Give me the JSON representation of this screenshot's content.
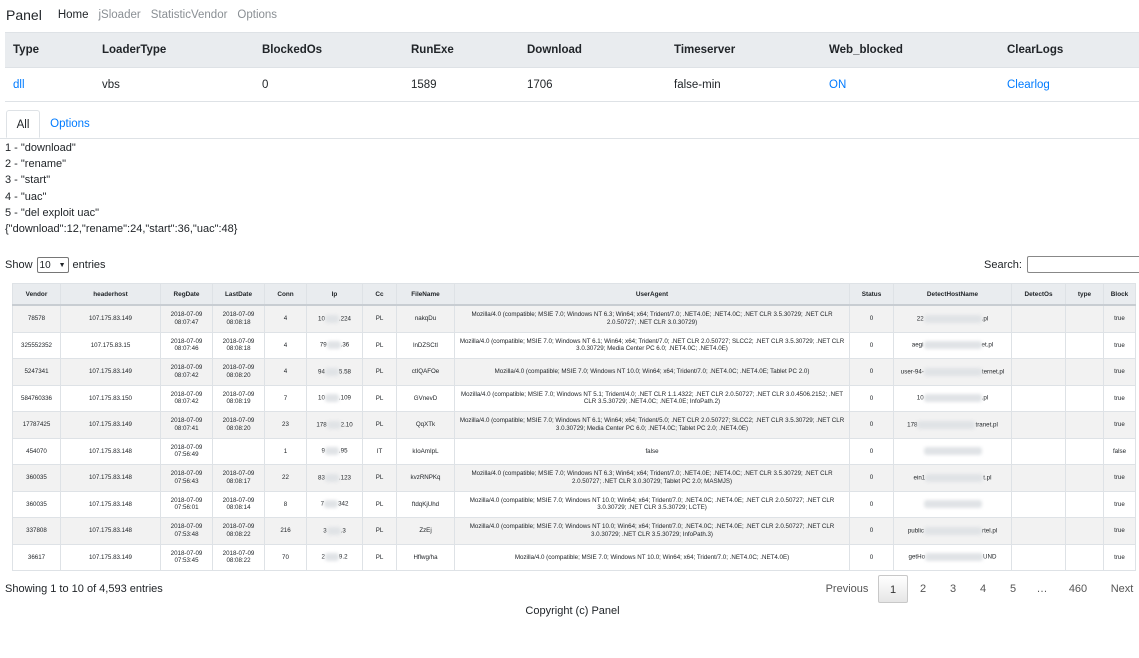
{
  "nav": {
    "brand": "Panel",
    "items": [
      "Home",
      "jSloader",
      "StatisticVendor",
      "Options"
    ]
  },
  "summary": {
    "headers": [
      "Type",
      "LoaderType",
      "BlockedOs",
      "RunExe",
      "Download",
      "Timeserver",
      "Web_blocked",
      "ClearLogs"
    ],
    "row": [
      "dll",
      "vbs",
      "0",
      "1589",
      "1706",
      "false-min",
      "ON",
      "Clearlog"
    ]
  },
  "tabs": [
    "All",
    "Options"
  ],
  "legend": [
    "1 - \"download\"",
    "2 - \"rename\"",
    "3 - \"start\"",
    "4 - \"uac\"",
    "5 - \"del exploit uac\"",
    "{\"download\":12,\"rename\":24,\"start\":36,\"uac\":48}"
  ],
  "length": {
    "show": "Show",
    "value": "10",
    "entries": "entries"
  },
  "search": {
    "label": "Search:"
  },
  "table": {
    "headers": [
      "Vendor",
      "headerhost",
      "RegDate",
      "LastDate",
      "Conn",
      "Ip",
      "Cc",
      "FileName",
      "UserAgent",
      "Status",
      "DetectHostName",
      "DetectOs",
      "type",
      "Block"
    ],
    "rows": [
      {
        "vendor": "78578",
        "host": "107.175.83.149",
        "reg": "2018-07-09 08:07:47",
        "last": "2018-07-09 08:08:18",
        "conn": "4",
        "ip_a": "10",
        "ip_b": ".224",
        "cc": "PL",
        "file": "nakqDu",
        "ua": "Mozilla/4.0 (compatible; MSIE 7.0; Windows NT 6.3; Win64; x64; Trident/7.0; .NET4.0E; .NET4.0C; .NET CLR 3.5.30729; .NET CLR 2.0.50727; .NET CLR 3.0.30729)",
        "status": "0",
        "dh_a": "22",
        "dh_b": ".pl",
        "block": "true"
      },
      {
        "vendor": "325552352",
        "host": "107.175.83.15",
        "reg": "2018-07-09 08:07:46",
        "last": "2018-07-09 08:08:18",
        "conn": "4",
        "ip_a": "79",
        "ip_b": ".36",
        "cc": "PL",
        "file": "lnDZSCtl",
        "ua": "Mozilla/4.0 (compatible; MSIE 7.0; Windows NT 6.1; Win64; x64; Trident/7.0; .NET CLR 2.0.50727; SLCC2; .NET CLR 3.5.30729; .NET CLR 3.0.30729; Media Center PC 6.0; .NET4.0C; .NET4.0E)",
        "status": "0",
        "dh_a": "aegi",
        "dh_b": "et.pl",
        "block": "true"
      },
      {
        "vendor": "5247341",
        "host": "107.175.83.149",
        "reg": "2018-07-09 08:07:42",
        "last": "2018-07-09 08:08:20",
        "conn": "4",
        "ip_a": "94",
        "ip_b": "5.58",
        "cc": "PL",
        "file": "ctIQAFOe",
        "ua": "Mozilla/4.0 (compatible; MSIE 7.0; Windows NT 10.0; Win64; x64; Trident/7.0; .NET4.0C; .NET4.0E; Tablet PC 2.0)",
        "status": "0",
        "dh_a": "user-94-",
        "dh_b": "ternet.pl",
        "block": "true"
      },
      {
        "vendor": "584760336",
        "host": "107.175.83.150",
        "reg": "2018-07-09 08:07:42",
        "last": "2018-07-09 08:08:19",
        "conn": "7",
        "ip_a": "10",
        "ip_b": ".109",
        "cc": "PL",
        "file": "GVnevD",
        "ua": "Mozilla/4.0 (compatible; MSIE 7.0; Windows NT 5.1; Trident/4.0; .NET CLR 1.1.4322; .NET CLR 2.0.50727; .NET CLR 3.0.4506.2152; .NET CLR 3.5.30729; .NET4.0C; .NET4.0E; InfoPath.2)",
        "status": "0",
        "dh_a": "10",
        "dh_b": ".pl",
        "block": "true"
      },
      {
        "vendor": "17787425",
        "host": "107.175.83.149",
        "reg": "2018-07-09 08:07:41",
        "last": "2018-07-09 08:08:20",
        "conn": "23",
        "ip_a": "178",
        "ip_b": "2.10",
        "cc": "PL",
        "file": "QqXTk",
        "ua": "Mozilla/4.0 (compatible; MSIE 7.0; Windows NT 6.1; Win64; x64; Trident/5.0; .NET CLR 2.0.50727; SLCC2; .NET CLR 3.5.30729; .NET CLR 3.0.30729; Media Center PC 6.0; .NET4.0C; Tablet PC 2.0; .NET4.0E)",
        "status": "0",
        "dh_a": "178",
        "dh_b": "tranet.pl",
        "block": "true"
      },
      {
        "vendor": "454070",
        "host": "107.175.83.148",
        "reg": "2018-07-09 07:56:49",
        "last": "",
        "conn": "1",
        "ip_a": "9",
        "ip_b": ".95",
        "cc": "IT",
        "file": "kIoAmIpL",
        "ua": "false",
        "status": "0",
        "dh_a": "",
        "dh_b": "",
        "block": "false"
      },
      {
        "vendor": "360035",
        "host": "107.175.83.148",
        "reg": "2018-07-09 07:56:43",
        "last": "2018-07-09 08:08:17",
        "conn": "22",
        "ip_a": "83",
        "ip_b": ".123",
        "cc": "PL",
        "file": "kvzRNPKq",
        "ua": "Mozilla/4.0 (compatible; MSIE 7.0; Windows NT 6.3; Win64; x64; Trident/7.0; .NET4.0E; .NET4.0C; .NET CLR 3.5.30729; .NET CLR 2.0.50727; .NET CLR 3.0.30729; Tablet PC 2.0; MASMJS)",
        "status": "0",
        "dh_a": "ein1",
        "dh_b": "t.pl",
        "block": "true"
      },
      {
        "vendor": "360035",
        "host": "107.175.83.148",
        "reg": "2018-07-09 07:56:01",
        "last": "2018-07-09 08:08:14",
        "conn": "8",
        "ip_a": "7",
        "ip_b": "342",
        "cc": "PL",
        "file": "ftdqKjUhd",
        "ua": "Mozilla/4.0 (compatible; MSIE 7.0; Windows NT 10.0; Win64; x64; Trident/7.0; .NET4.0C; .NET4.0E; .NET CLR 2.0.50727; .NET CLR 3.0.30729; .NET CLR 3.5.30729; LCTE)",
        "status": "0",
        "dh_a": "",
        "dh_b": "",
        "block": "true"
      },
      {
        "vendor": "337808",
        "host": "107.175.83.148",
        "reg": "2018-07-09 07:53:48",
        "last": "2018-07-09 08:08:22",
        "conn": "216",
        "ip_a": "3",
        "ip_b": ".3",
        "cc": "PL",
        "file": "ZzEj",
        "ua": "Mozilla/4.0 (compatible; MSIE 7.0; Windows NT 10.0; Win64; x64; Trident/7.0; .NET4.0C; .NET4.0E; .NET CLR 2.0.50727; .NET CLR 3.0.30729; .NET CLR 3.5.30729; InfoPath.3)",
        "status": "0",
        "dh_a": "public",
        "dh_b": "rtel.pl",
        "block": "true"
      },
      {
        "vendor": "36617",
        "host": "107.175.83.149",
        "reg": "2018-07-09 07:53:45",
        "last": "2018-07-09 08:08:22",
        "conn": "70",
        "ip_a": "2",
        "ip_b": "9.2",
        "cc": "PL",
        "file": "Hflwg/ha",
        "ua": "Mozilla/4.0 (compatible; MSIE 7.0; Windows NT 10.0; Win64; x64; Trident/7.0; .NET4.0C; .NET4.0E)",
        "status": "0",
        "dh_a": "getHo",
        "dh_b": "UND",
        "block": "true"
      }
    ]
  },
  "footer": {
    "info": "Showing 1 to 10 of 4,593 entries",
    "pager": [
      "Previous",
      "1",
      "2",
      "3",
      "4",
      "5",
      "…",
      "460",
      "Next"
    ],
    "copyright": "Copyright (c) Panel"
  }
}
